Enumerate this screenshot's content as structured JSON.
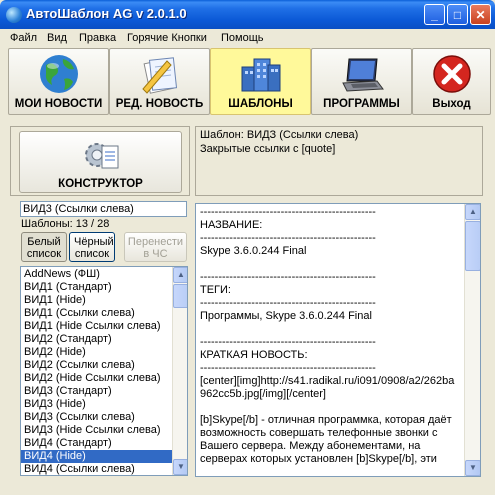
{
  "window": {
    "title": "АвтоШаблон AG v 2.0.1.0"
  },
  "menu": [
    "Файл",
    "Вид",
    "Правка",
    "Горячие Кнопки",
    "Помощь"
  ],
  "toolbar": {
    "items": [
      {
        "label": "МОИ НОВОСТИ",
        "icon": "globe-icon",
        "active": false
      },
      {
        "label": "РЕД. НОВОСТЬ",
        "icon": "edit-document-icon",
        "active": false
      },
      {
        "label": "ШАБЛОНЫ",
        "icon": "building-icon",
        "active": true
      },
      {
        "label": "ПРОГРАММЫ",
        "icon": "laptop-icon",
        "active": false
      },
      {
        "label": "Выход",
        "icon": "exit-icon",
        "active": false
      }
    ]
  },
  "constructor_button": {
    "label": "КОНСТРУКТОР",
    "icon": "gear-document-icon"
  },
  "template_info": {
    "line1": "Шаблон: ВИДЗ (Ссылки слева)",
    "line2": "Закрытые ссылки с [quote]"
  },
  "template_name_field": {
    "value": "ВИД3 (Ссылки слева)"
  },
  "template_count": "Шаблоны: 13 / 28",
  "buttons": {
    "white_list": "Белый список",
    "black_list": "Чёрный список",
    "move_to_cs": "Перенести в ЧС"
  },
  "template_list": {
    "selected_index": 14,
    "items": [
      "AddNews (ФШ)",
      "ВИД1 (Стандарт)",
      "ВИД1 (Hide)",
      "ВИД1 (Ссылки слева)",
      "ВИД1 (Hide Ссылки слева)",
      "ВИД2 (Стандарт)",
      "ВИД2 (Hide)",
      "ВИД2 (Ссылки слева)",
      "ВИД2 (Hide Ссылки слева)",
      "ВИД3 (Стандарт)",
      "ВИД3 (Hide)",
      "ВИД3 (Ссылки слева)",
      "ВИД3 (Hide Ссылки слева)",
      "ВИД4 (Стандарт)",
      "ВИД4 (Hide)",
      "ВИД4 (Ссылки слева)"
    ]
  },
  "preview": {
    "lines": [
      "------------------------------------------------",
      "НАЗВАНИЕ:",
      "------------------------------------------------",
      "Skype 3.6.0.244 Final",
      "",
      "------------------------------------------------",
      "ТЕГИ:",
      "------------------------------------------------",
      "Программы, Skype 3.6.0.244 Final",
      "",
      "------------------------------------------------",
      "КРАТКАЯ НОВОСТЬ:",
      "------------------------------------------------",
      "[center][img]http://s41.radikal.ru/i091/0908/a2/262ba",
      "962cc5b.jpg[/img][/center]",
      "",
      "[b]Skype[/b] - отличная программка, которая даёт",
      "возможность совершать телефонные звонки с",
      "Вашего сервера. Между абонементами, на",
      "серверах которых установлен [b]Skype[/b], эти"
    ]
  }
}
